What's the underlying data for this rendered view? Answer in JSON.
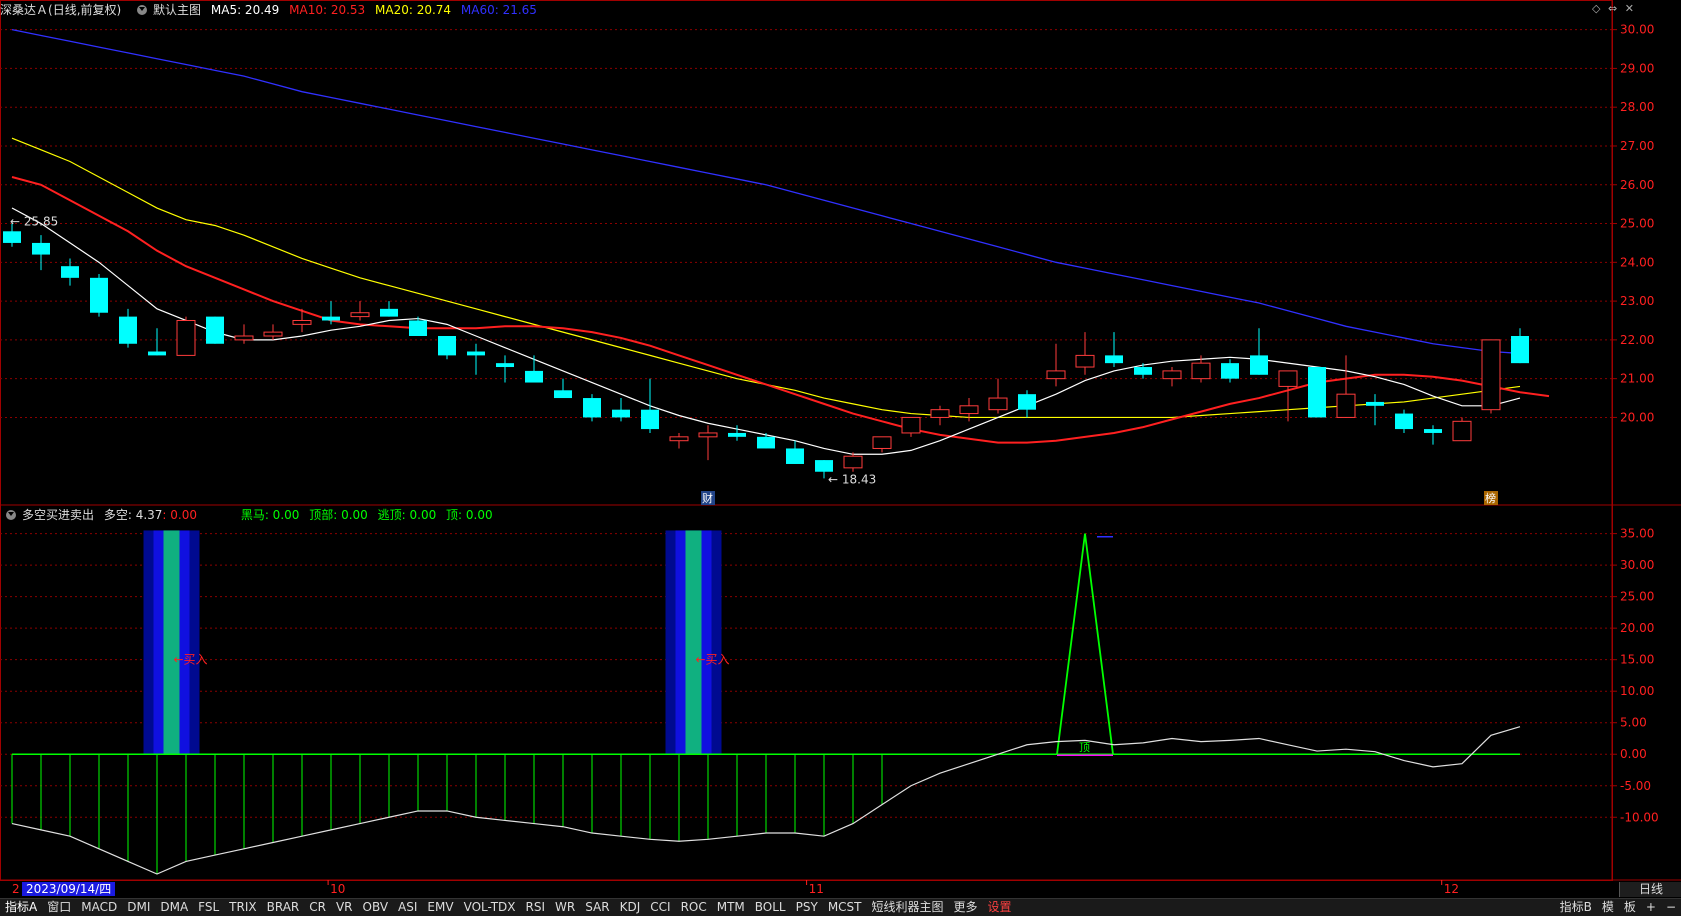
{
  "header": {
    "stock_name": "深桑达Ａ",
    "period_mode": "(日线,前复权)",
    "main_chart_label": "默认主图",
    "ma": [
      {
        "label": "MA5: 20.49",
        "color": "#ffffff"
      },
      {
        "label": "MA10: 20.53",
        "color": "#ff2020"
      },
      {
        "label": "MA20: 20.74",
        "color": "#ffff00"
      },
      {
        "label": "MA60: 21.65",
        "color": "#3030ff"
      }
    ]
  },
  "indicator_header": {
    "name": "多空买进卖出",
    "duokong": "多空: 4.37",
    "zero": ": 0.00",
    "heima": "黑马: 0.00",
    "dingbu": "顶部: 0.00",
    "taoding": "逃顶: 0.00",
    "ding": "顶: 0.00"
  },
  "annotations": {
    "high": "25.85",
    "low": "18.43",
    "buy1": "买入",
    "buy2": "买入",
    "cai": "财",
    "bang": "榜",
    "ding_marker": "顶"
  },
  "price_axis": [
    "30.00",
    "29.00",
    "28.00",
    "27.00",
    "26.00",
    "25.00",
    "24.00",
    "23.00",
    "22.00",
    "21.00",
    "20.00"
  ],
  "ind_axis": [
    "35.00",
    "30.00",
    "25.00",
    "20.00",
    "15.00",
    "10.00",
    "5.00",
    "0.00",
    "-5.00",
    "-10.00"
  ],
  "date_axis": {
    "cursor_date": "2023/09/14/四",
    "start_label": "2",
    "months": [
      "10",
      "11",
      "12"
    ],
    "period": "日线"
  },
  "toolbar": {
    "items": [
      "指标A",
      "窗口",
      "MACD",
      "DMI",
      "DMA",
      "FSL",
      "TRIX",
      "BRAR",
      "CR",
      "VR",
      "OBV",
      "ASI",
      "EMV",
      "VOL-TDX",
      "RSI",
      "WR",
      "SAR",
      "KDJ",
      "CCI",
      "ROC",
      "MTM",
      "BOLL",
      "PSY",
      "MCST",
      "短线利器主图",
      "更多"
    ],
    "settings": "设置",
    "right_items": [
      "指标B",
      "模",
      "板",
      "+",
      "−"
    ]
  },
  "top_icons": [
    "◇",
    "⇔",
    "✕"
  ],
  "colors": {
    "up": "#ff3c3c",
    "down": "#00ffff",
    "ma5": "#ffffff",
    "ma10": "#ff2020",
    "ma20": "#ffff00",
    "ma60": "#3030ff",
    "grid": "#8b0000",
    "axis_text": "#ff2020",
    "indicator_line": "#00ff00"
  },
  "chart_data": {
    "type": "candlestick",
    "candles": [
      {
        "o": 24.8,
        "h": 25.0,
        "l": 24.4,
        "c": 24.5
      },
      {
        "o": 24.5,
        "h": 24.7,
        "l": 23.8,
        "c": 24.2
      },
      {
        "o": 23.9,
        "h": 24.1,
        "l": 23.4,
        "c": 23.6
      },
      {
        "o": 23.6,
        "h": 23.7,
        "l": 22.6,
        "c": 22.7
      },
      {
        "o": 22.6,
        "h": 22.8,
        "l": 21.8,
        "c": 21.9
      },
      {
        "o": 21.7,
        "h": 22.3,
        "l": 21.6,
        "c": 21.6
      },
      {
        "o": 21.6,
        "h": 22.6,
        "l": 21.6,
        "c": 22.5
      },
      {
        "o": 22.6,
        "h": 22.6,
        "l": 21.9,
        "c": 21.9
      },
      {
        "o": 22.0,
        "h": 22.4,
        "l": 21.9,
        "c": 22.1
      },
      {
        "o": 22.1,
        "h": 22.4,
        "l": 22.0,
        "c": 22.2
      },
      {
        "o": 22.4,
        "h": 22.8,
        "l": 22.2,
        "c": 22.5
      },
      {
        "o": 22.6,
        "h": 23.0,
        "l": 22.4,
        "c": 22.5
      },
      {
        "o": 22.6,
        "h": 23.0,
        "l": 22.5,
        "c": 22.7
      },
      {
        "o": 22.8,
        "h": 23.0,
        "l": 22.6,
        "c": 22.6
      },
      {
        "o": 22.5,
        "h": 22.6,
        "l": 22.1,
        "c": 22.1
      },
      {
        "o": 22.1,
        "h": 22.1,
        "l": 21.5,
        "c": 21.6
      },
      {
        "o": 21.7,
        "h": 21.9,
        "l": 21.1,
        "c": 21.6
      },
      {
        "o": 21.4,
        "h": 21.6,
        "l": 20.9,
        "c": 21.3
      },
      {
        "o": 21.2,
        "h": 21.6,
        "l": 20.9,
        "c": 20.9
      },
      {
        "o": 20.7,
        "h": 21.0,
        "l": 20.5,
        "c": 20.5
      },
      {
        "o": 20.5,
        "h": 20.6,
        "l": 19.9,
        "c": 20.0
      },
      {
        "o": 20.2,
        "h": 20.5,
        "l": 19.9,
        "c": 20.0
      },
      {
        "o": 20.2,
        "h": 21.0,
        "l": 19.6,
        "c": 19.7
      },
      {
        "o": 19.4,
        "h": 19.6,
        "l": 19.2,
        "c": 19.5
      },
      {
        "o": 19.5,
        "h": 19.8,
        "l": 18.9,
        "c": 19.6
      },
      {
        "o": 19.6,
        "h": 19.8,
        "l": 19.4,
        "c": 19.5
      },
      {
        "o": 19.5,
        "h": 19.6,
        "l": 19.2,
        "c": 19.2
      },
      {
        "o": 19.2,
        "h": 19.4,
        "l": 18.8,
        "c": 18.8
      },
      {
        "o": 18.9,
        "h": 18.9,
        "l": 18.43,
        "c": 18.6
      },
      {
        "o": 18.7,
        "h": 19.1,
        "l": 18.6,
        "c": 19.0
      },
      {
        "o": 19.2,
        "h": 19.5,
        "l": 19.1,
        "c": 19.5
      },
      {
        "o": 19.6,
        "h": 20.0,
        "l": 19.5,
        "c": 20.0
      },
      {
        "o": 20.0,
        "h": 20.3,
        "l": 19.8,
        "c": 20.2
      },
      {
        "o": 20.1,
        "h": 20.5,
        "l": 19.9,
        "c": 20.3
      },
      {
        "o": 20.2,
        "h": 21.0,
        "l": 20.1,
        "c": 20.5
      },
      {
        "o": 20.6,
        "h": 20.7,
        "l": 20.0,
        "c": 20.2
      },
      {
        "o": 21.0,
        "h": 21.9,
        "l": 20.8,
        "c": 21.2
      },
      {
        "o": 21.3,
        "h": 22.2,
        "l": 21.1,
        "c": 21.6
      },
      {
        "o": 21.6,
        "h": 22.2,
        "l": 21.3,
        "c": 21.4
      },
      {
        "o": 21.3,
        "h": 21.4,
        "l": 21.0,
        "c": 21.1
      },
      {
        "o": 21.0,
        "h": 21.3,
        "l": 20.8,
        "c": 21.2
      },
      {
        "o": 21.0,
        "h": 21.6,
        "l": 20.9,
        "c": 21.4
      },
      {
        "o": 21.4,
        "h": 21.5,
        "l": 20.9,
        "c": 21.0
      },
      {
        "o": 21.6,
        "h": 22.3,
        "l": 21.1,
        "c": 21.1
      },
      {
        "o": 20.8,
        "h": 21.0,
        "l": 19.9,
        "c": 21.2
      },
      {
        "o": 21.3,
        "h": 21.3,
        "l": 20.0,
        "c": 20.0
      },
      {
        "o": 20.0,
        "h": 21.6,
        "l": 20.0,
        "c": 20.6
      },
      {
        "o": 20.4,
        "h": 20.6,
        "l": 19.8,
        "c": 20.3
      },
      {
        "o": 20.1,
        "h": 20.2,
        "l": 19.6,
        "c": 19.7
      },
      {
        "o": 19.7,
        "h": 19.8,
        "l": 19.3,
        "c": 19.6
      },
      {
        "o": 19.4,
        "h": 20.0,
        "l": 19.4,
        "c": 19.9
      },
      {
        "o": 20.2,
        "h": 22.0,
        "l": 20.1,
        "c": 22.0
      },
      {
        "o": 22.1,
        "h": 22.3,
        "l": 21.4,
        "c": 21.4
      }
    ],
    "ma5": [
      25.4,
      25.0,
      24.5,
      24.0,
      23.4,
      22.8,
      22.5,
      22.2,
      22.0,
      22.0,
      22.1,
      22.25,
      22.35,
      22.5,
      22.55,
      22.4,
      22.1,
      21.8,
      21.5,
      21.2,
      20.9,
      20.6,
      20.3,
      20.05,
      19.85,
      19.7,
      19.55,
      19.4,
      19.2,
      19.05,
      19.05,
      19.15,
      19.4,
      19.7,
      20.0,
      20.3,
      20.6,
      20.95,
      21.2,
      21.35,
      21.45,
      21.5,
      21.55,
      21.5,
      21.4,
      21.3,
      21.2,
      21.05,
      20.85,
      20.55,
      20.3,
      20.3,
      20.5
    ],
    "ma10": [
      26.2,
      26.0,
      25.6,
      25.2,
      24.8,
      24.3,
      23.9,
      23.6,
      23.3,
      23.0,
      22.75,
      22.5,
      22.4,
      22.35,
      22.3,
      22.3,
      22.3,
      22.35,
      22.35,
      22.3,
      22.2,
      22.05,
      21.85,
      21.6,
      21.35,
      21.1,
      20.85,
      20.6,
      20.35,
      20.1,
      19.9,
      19.7,
      19.55,
      19.45,
      19.35,
      19.35,
      19.4,
      19.5,
      19.6,
      19.75,
      19.95,
      20.15,
      20.35,
      20.5,
      20.7,
      20.9,
      21.0,
      21.1,
      21.1,
      21.05,
      20.95,
      20.8,
      20.65,
      20.55
    ],
    "ma20": [
      27.2,
      26.9,
      26.6,
      26.2,
      25.8,
      25.4,
      25.1,
      24.95,
      24.7,
      24.4,
      24.1,
      23.85,
      23.6,
      23.4,
      23.2,
      23.0,
      22.8,
      22.6,
      22.4,
      22.2,
      22.0,
      21.8,
      21.6,
      21.4,
      21.2,
      21.0,
      20.85,
      20.7,
      20.5,
      20.35,
      20.2,
      20.1,
      20.05,
      20.0,
      20.0,
      20.0,
      20.0,
      20.0,
      20.0,
      20.0,
      20.0,
      20.05,
      20.1,
      20.15,
      20.2,
      20.25,
      20.3,
      20.35,
      20.4,
      20.5,
      20.6,
      20.7,
      20.8
    ],
    "ma60": [
      30.0,
      29.85,
      29.7,
      29.55,
      29.4,
      29.25,
      29.1,
      28.95,
      28.8,
      28.6,
      28.4,
      28.25,
      28.1,
      27.95,
      27.8,
      27.65,
      27.5,
      27.35,
      27.2,
      27.05,
      26.9,
      26.75,
      26.6,
      26.45,
      26.3,
      26.15,
      26.0,
      25.8,
      25.6,
      25.4,
      25.2,
      25.0,
      24.8,
      24.6,
      24.4,
      24.2,
      24.0,
      23.85,
      23.7,
      23.55,
      23.4,
      23.25,
      23.1,
      22.95,
      22.75,
      22.55,
      22.35,
      22.2,
      22.05,
      21.9,
      21.8,
      21.7,
      21.65
    ],
    "indicator": {
      "curve": [
        -11,
        -12,
        -13,
        -15,
        -17,
        -19,
        -17,
        -16,
        -15,
        -14,
        -13,
        -12,
        -11,
        -10,
        -9,
        -9,
        -10,
        -10.5,
        -11,
        -11.5,
        -12.5,
        -13,
        -13.5,
        -13.8,
        -13.5,
        -13,
        -12.5,
        -12.5,
        -13,
        -11,
        -8,
        -5,
        -3,
        -1.5,
        0,
        1.5,
        2,
        2.2,
        1.5,
        1.8,
        2.5,
        2,
        2.2,
        2.5,
        1.5,
        0.5,
        0.8,
        0.4,
        -1,
        -2,
        -1.5,
        3,
        4.37
      ],
      "bars_negative_from": 0,
      "bars_negative_to": 30,
      "spike_peak": 35,
      "ylim": [
        -19,
        37
      ]
    },
    "ylim": [
      18.0,
      30.3
    ]
  }
}
